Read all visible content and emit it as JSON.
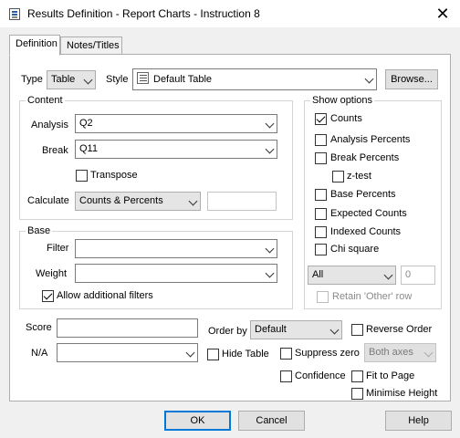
{
  "window": {
    "title": "Results Definition - Report Charts - Instruction 8",
    "close_glyph": "✕"
  },
  "tabs": [
    {
      "label": "Definition",
      "active": true
    },
    {
      "label": "Notes/Titles",
      "active": false
    }
  ],
  "top_row": {
    "type_label": "Type",
    "type_value": "Table",
    "style_label": "Style",
    "style_value": "Default Table",
    "browse_label": "Browse..."
  },
  "content": {
    "title": "Content",
    "analysis_label": "Analysis",
    "analysis_value": "Q2",
    "break_label": "Break",
    "break_value": "Q11",
    "transpose_label": "Transpose",
    "transpose_checked": false,
    "calculate_label": "Calculate",
    "calculate_value": "Counts & Percents",
    "calculate_extra": ""
  },
  "show_options": {
    "title": "Show options",
    "items": [
      {
        "label": "Counts",
        "checked": true
      },
      {
        "label": "Analysis Percents",
        "checked": false
      },
      {
        "label": "Break Percents",
        "checked": false
      },
      {
        "label": "z-test",
        "checked": false
      },
      {
        "label": "Base Percents",
        "checked": false
      },
      {
        "label": "Expected Counts",
        "checked": false
      },
      {
        "label": "Indexed Counts",
        "checked": false
      },
      {
        "label": "Chi square",
        "checked": false
      }
    ],
    "all_value": "All",
    "number_value": "0",
    "retain_label": "Retain 'Other' row"
  },
  "base": {
    "title": "Base",
    "filter_label": "Filter",
    "filter_value": "",
    "weight_label": "Weight",
    "weight_value": "",
    "allow_label": "Allow additional filters",
    "allow_checked": true
  },
  "bottom": {
    "score_label": "Score",
    "score_value": "",
    "na_label": "N/A",
    "na_value": "",
    "order_by_label": "Order by",
    "order_by_value": "Default",
    "reverse_order_label": "Reverse Order",
    "hide_table_label": "Hide Table",
    "suppress_zero_label": "Suppress zero",
    "both_axes_value": "Both axes",
    "confidence_label": "Confidence",
    "fit_to_page_label": "Fit to Page",
    "minimise_height_label": "Minimise Height"
  },
  "buttons": {
    "ok": "OK",
    "cancel": "Cancel",
    "help": "Help"
  }
}
